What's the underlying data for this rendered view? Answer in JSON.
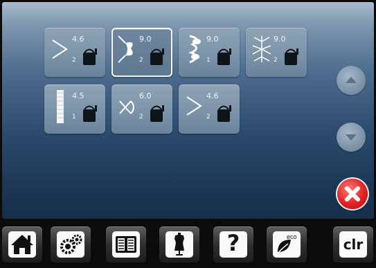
{
  "stitch_tiles": [
    {
      "value": "4.6",
      "sub": "2",
      "icon": "zigzag-stitch-icon"
    },
    {
      "value": "9.0",
      "sub": "2",
      "icon": "floral-motif-stitch-icon"
    },
    {
      "value": "9.0",
      "sub": "1",
      "icon": "leaf-motif-stitch-icon"
    },
    {
      "value": "9.0",
      "sub": "2",
      "icon": "star-motif-stitch-icon"
    },
    {
      "value": "4.5",
      "sub": "1",
      "icon": "satin-bar-stitch-icon"
    },
    {
      "value": "6.0",
      "sub": "2",
      "icon": "cross-stitch-icon"
    },
    {
      "value": "4.6",
      "sub": "2",
      "icon": "zigzag-stitch-icon"
    }
  ],
  "toolbar": {
    "help_label": "?",
    "clr_label": "clr",
    "eco_label": "eco"
  }
}
